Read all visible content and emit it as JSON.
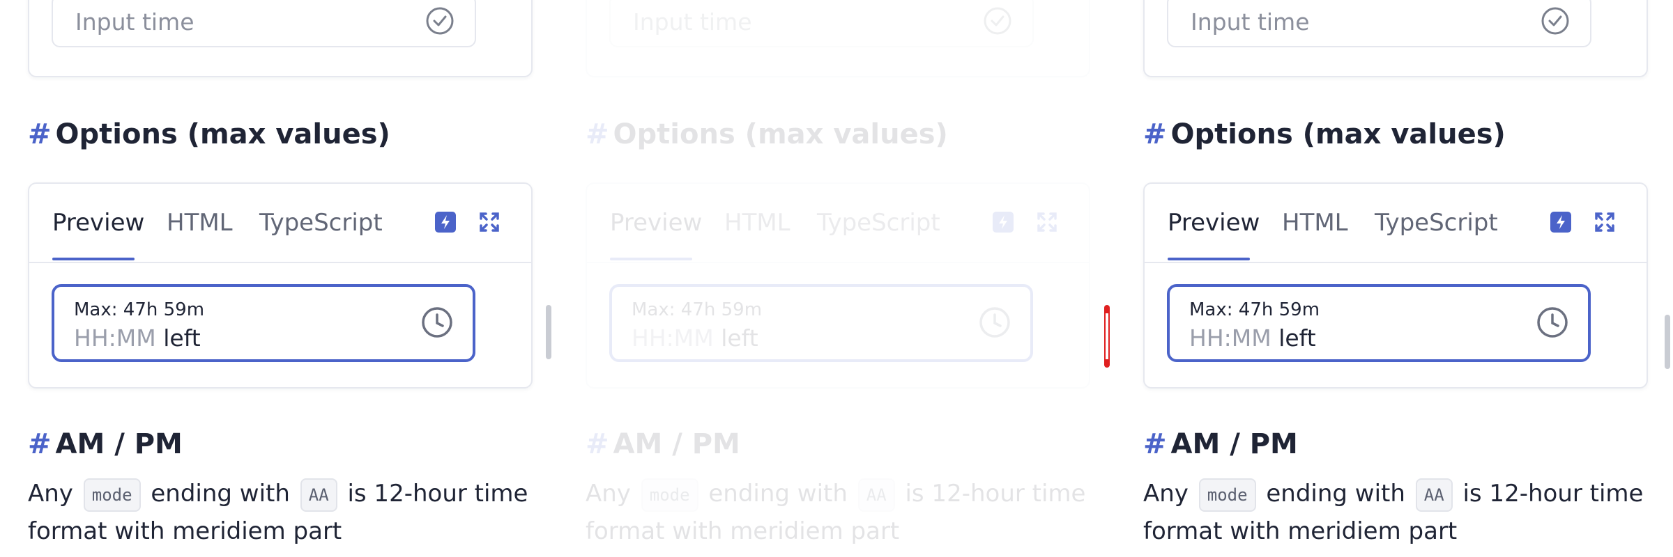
{
  "top_field": {
    "placeholder": "Input time",
    "icon": "check-circle-icon"
  },
  "section_options": {
    "hash": "#",
    "title": "Options (max values)"
  },
  "demo": {
    "tabs": [
      "Preview",
      "HTML",
      "TypeScript"
    ],
    "tools": [
      "stackblitz-icon",
      "expand-icon"
    ],
    "field": {
      "label": "Max: 47h 59m",
      "placeholder": "HH:MM",
      "suffix": "left",
      "icon": "clock-icon"
    }
  },
  "section_ampm": {
    "hash": "#",
    "title": "AM / PM",
    "text_1": "Any",
    "code_1": "mode",
    "text_2": "ending with",
    "code_2": "AA",
    "text_3": "is 12-hour time format with meridiem part"
  },
  "colors": {
    "accent": "#4b63c9",
    "text": "#1f2435",
    "muted": "#8b8f9c",
    "border": "#e6e8ef"
  }
}
